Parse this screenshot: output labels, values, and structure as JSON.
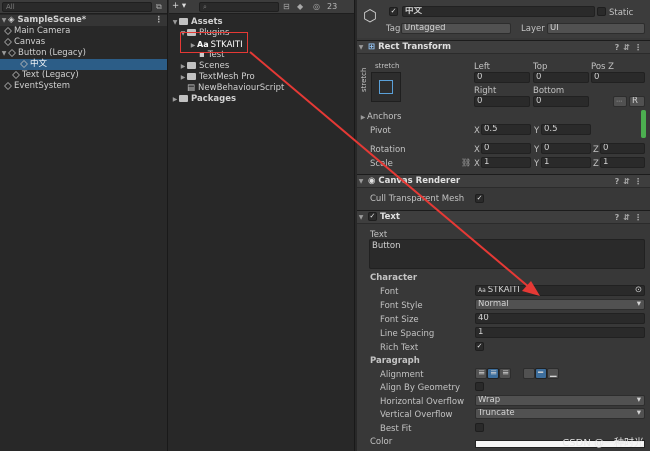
{
  "hierarchy": {
    "search_placeholder": "All",
    "scene": "SampleScene*",
    "items": [
      {
        "label": "Main Camera"
      },
      {
        "label": "Canvas"
      },
      {
        "label": "Button (Legacy)"
      },
      {
        "label": "中文"
      },
      {
        "label": "Text (Legacy)"
      },
      {
        "label": "EventSystem"
      }
    ]
  },
  "project": {
    "add_label": "+ ▾",
    "count_label": "23",
    "assets": "Assets",
    "plugins": "Plugins",
    "font_asset": "STKAITI",
    "font_prefix": "Aa",
    "test": "Test",
    "scenes": "Scenes",
    "textmesh": "TextMesh Pro",
    "script": "NewBehaviourScript",
    "packages": "Packages"
  },
  "inspector": {
    "object_name": "中文",
    "static_label": "Static",
    "tag_label": "Tag",
    "tag_value": "Untagged",
    "layer_label": "Layer",
    "layer_value": "UI",
    "rect_transform": {
      "title": "Rect Transform",
      "stretch_top": "stretch",
      "stretch_side": "stretch",
      "left_label": "Left",
      "left_value": "0",
      "top_label": "Top",
      "top_value": "0",
      "posz_label": "Pos Z",
      "posz_value": "0",
      "right_label": "Right",
      "right_value": "0",
      "bottom_label": "Bottom",
      "bottom_value": "0",
      "anchors_label": "Anchors",
      "pivot_label": "Pivot",
      "pivot_x": "0.5",
      "pivot_y": "0.5",
      "rotation_label": "Rotation",
      "rot_x": "0",
      "rot_y": "0",
      "rot_z": "0",
      "scale_label": "Scale",
      "scale_x": "1",
      "scale_y": "1",
      "scale_z": "1",
      "x": "X",
      "y": "Y",
      "z": "Z",
      "r_btn": "R"
    },
    "canvas_renderer": {
      "title": "Canvas Renderer",
      "cull_label": "Cull Transparent Mesh"
    },
    "text": {
      "title": "Text",
      "text_label": "Text",
      "text_value": "Button",
      "character_label": "Character",
      "font_label": "Font",
      "font_prefix": "Aa",
      "font_value": "STKAITI",
      "font_style_label": "Font Style",
      "font_style_value": "Normal",
      "font_size_label": "Font Size",
      "font_size_value": "40",
      "line_spacing_label": "Line Spacing",
      "line_spacing_value": "1",
      "rich_text_label": "Rich Text",
      "paragraph_label": "Paragraph",
      "alignment_label": "Alignment",
      "align_geometry_label": "Align By Geometry",
      "h_overflow_label": "Horizontal Overflow",
      "h_overflow_value": "Wrap",
      "v_overflow_label": "Vertical Overflow",
      "v_overflow_value": "Truncate",
      "best_fit_label": "Best Fit",
      "color_label": "Color"
    }
  },
  "watermark": "CSDN @一种时光",
  "colors": {
    "selection": "#2c5d87",
    "annotation": "#e53935"
  }
}
